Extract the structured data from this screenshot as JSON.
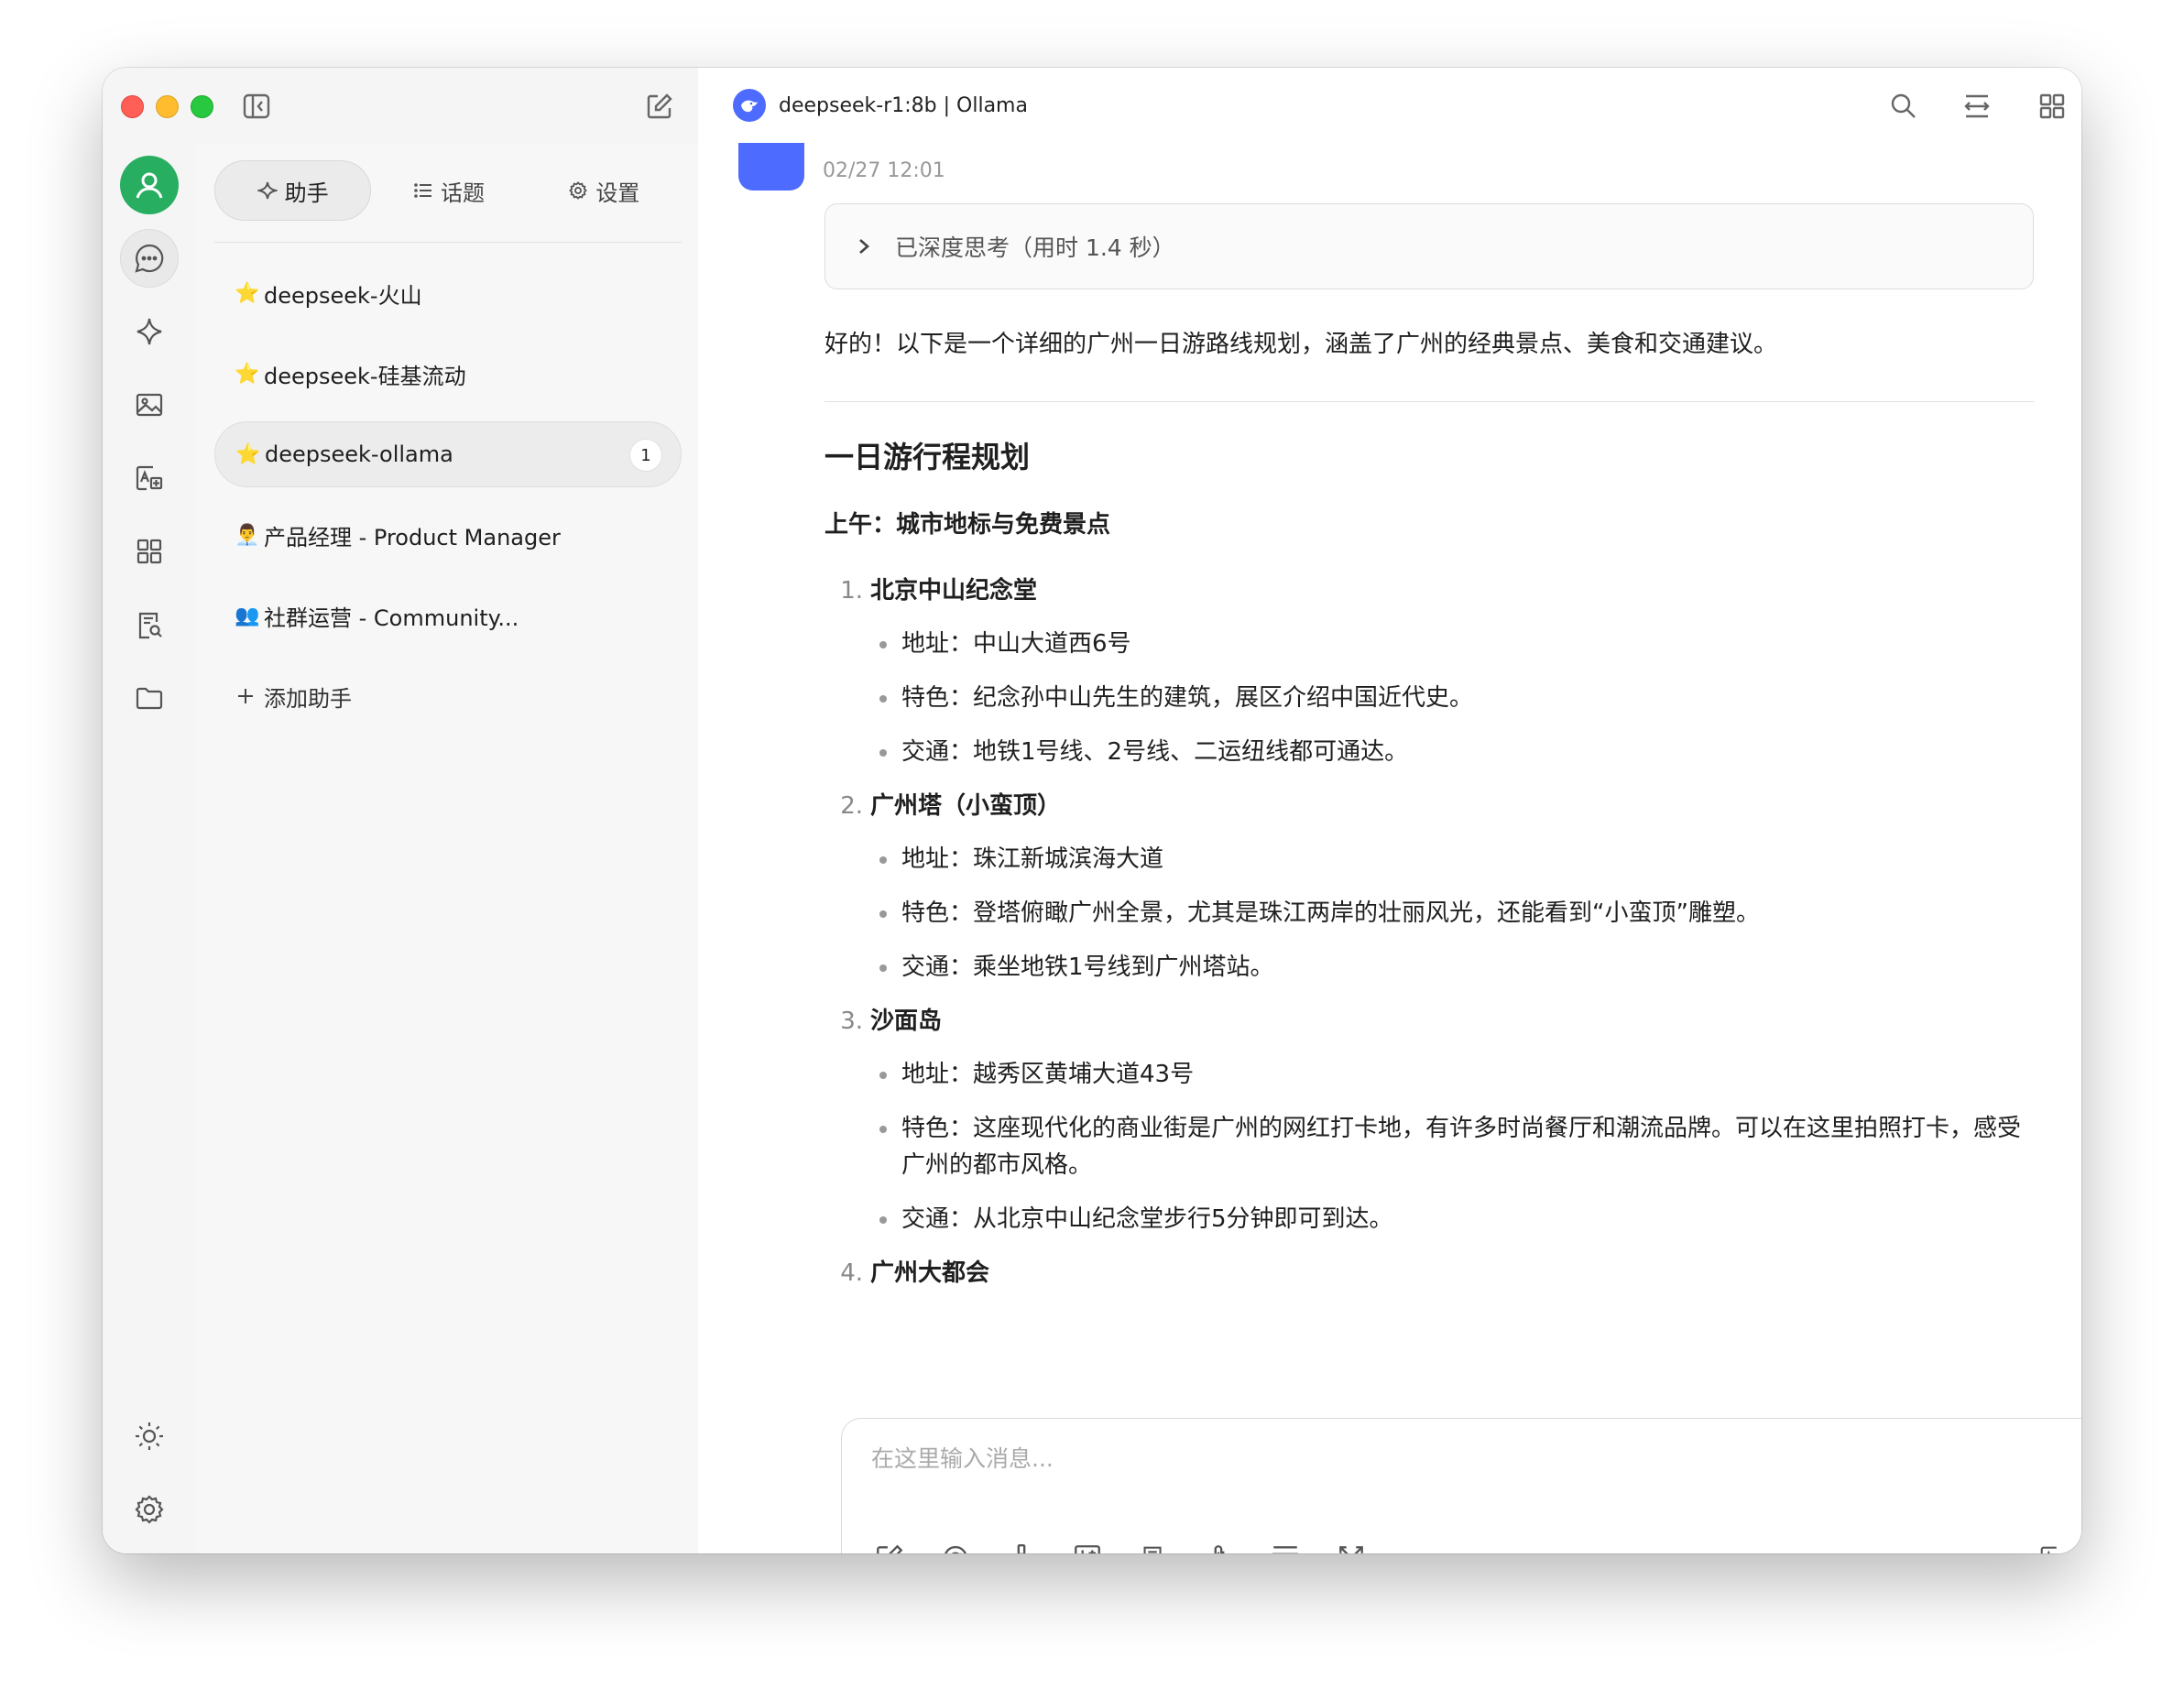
{
  "header": {
    "title": "deepseek-r1:8b | Ollama"
  },
  "panel": {
    "tabs": [
      {
        "label": "助手"
      },
      {
        "label": "话题"
      },
      {
        "label": "设置"
      }
    ],
    "assistants": [
      {
        "emoji": "⭐",
        "label": "deepseek-火山"
      },
      {
        "emoji": "⭐",
        "label": "deepseek-硅基流动"
      },
      {
        "emoji": "⭐",
        "label": "deepseek-ollama",
        "badge": "1"
      },
      {
        "emoji": "👨‍💼",
        "label": "产品经理 - Product Manager"
      },
      {
        "emoji": "👥",
        "label": "社群运营 - Community..."
      }
    ],
    "add_label": "添加助手"
  },
  "message": {
    "time": "02/27 12:01",
    "thinking_label": "已深度思考（用时 1.4 秒）",
    "intro": "好的！以下是一个详细的广州一日游路线规划，涵盖了广州的经典景点、美食和交通建议。",
    "heading": "一日游行程规划",
    "section": "上午：城市地标与免费景点",
    "spots": [
      {
        "num": "1.",
        "name": "北京中山纪念堂",
        "details": [
          "地址：中山大道西6号",
          "特色：纪念孙中山先生的建筑，展区介绍中国近代史。",
          "交通：地铁1号线、2号线、二运纽线都可通达。"
        ]
      },
      {
        "num": "2.",
        "name": "广州塔（小蛮顶）",
        "details": [
          "地址：珠江新城滨海大道",
          "特色：登塔俯瞰广州全景，尤其是珠江两岸的壮丽风光，还能看到“小蛮顶”雕塑。",
          "交通：乘坐地铁1号线到广州塔站。"
        ]
      },
      {
        "num": "3.",
        "name": "沙面岛",
        "details": [
          "地址：越秀区黄埔大道43号",
          "特色：这座现代化的商业街是广州的网红打卡地，有许多时尚餐厅和潮流品牌。可以在这里拍照打卡，感受广州的都市风格。",
          "交通：从北京中山纪念堂步行5分钟即可到达。"
        ]
      },
      {
        "num": "4.",
        "name": "广州大都会",
        "details": []
      }
    ]
  },
  "input": {
    "placeholder": "在这里输入消息..."
  },
  "colors": {
    "accent_green": "#27ae60",
    "deepseek_blue": "#4d6bfe"
  }
}
